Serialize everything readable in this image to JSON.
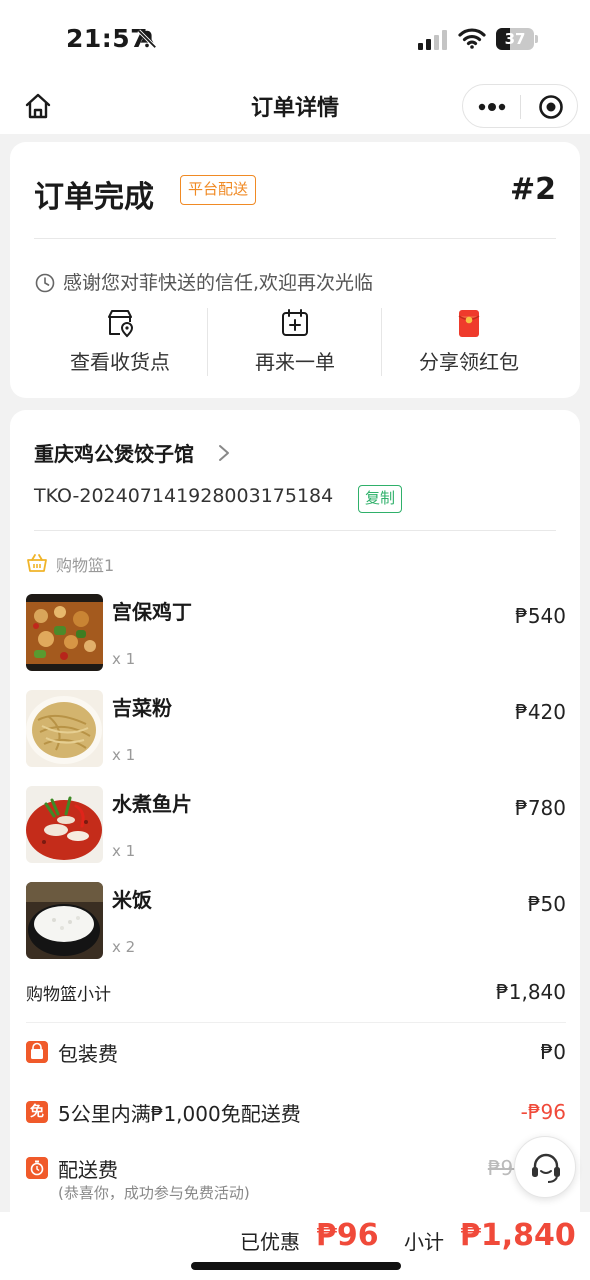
{
  "status_bar": {
    "time": "21:57",
    "battery": "37",
    "battery_level": 0.37
  },
  "nav": {
    "title": "订单详情",
    "home_icon": "home-icon",
    "more_icon": "more-icon",
    "mini_program_icon": "target-icon"
  },
  "order_status": {
    "title": "订单完成",
    "badge": "平台配送",
    "number": "#2",
    "thanks": "感谢您对菲快送的信任,欢迎再次光临",
    "actions": [
      {
        "label": "查看收货点",
        "icon": "pickup-point-icon"
      },
      {
        "label": "再来一单",
        "icon": "reorder-icon"
      },
      {
        "label": "分享领红包",
        "icon": "red-envelope-icon"
      }
    ]
  },
  "order": {
    "store_name": "重庆鸡公煲饺子馆",
    "order_id": "TKO-20240714192800317518​4",
    "copy_label": "复制",
    "basket_label": "购物篮1",
    "items": [
      {
        "name": "宫保鸡丁",
        "qty": "x 1",
        "price": "₱540"
      },
      {
        "name": "吉菜粉",
        "qty": "x 1",
        "price": "₱420"
      },
      {
        "name": "水煮鱼片",
        "qty": "x 1",
        "price": "₱780"
      },
      {
        "name": "米饭",
        "qty": "x 2",
        "price": "₱50"
      }
    ],
    "basket_subtotal_label": "购物篮小计",
    "basket_subtotal": "₱1,840",
    "packaging_label": "包装费",
    "packaging_fee": "₱0",
    "free_delivery_icon": "免",
    "free_delivery_label": "5公里内满₱1,000免配送费",
    "free_delivery_value": "-₱96",
    "delivery_label": "配送费",
    "delivery_note": "(恭喜你，成功参与免费活动)",
    "delivery_fee": "₱96"
  },
  "footer": {
    "saved_label": "已优惠",
    "saved_value": "₱96",
    "total_label": "小计",
    "total_value": "₱1,840"
  },
  "colors": {
    "accent_red": "#f04a3a",
    "badge_orange": "#f08a24",
    "copy_green": "#2fb06a"
  }
}
